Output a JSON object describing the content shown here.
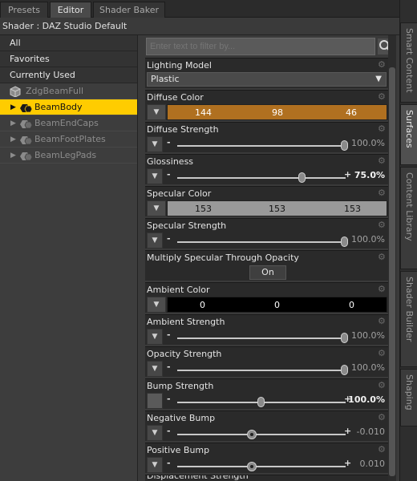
{
  "tabs": [
    "Presets",
    "Editor",
    "Shader Baker"
  ],
  "shader_line": "Shader : DAZ Studio Default",
  "left_categories": [
    "All",
    "Favorites",
    "Currently Used"
  ],
  "tree": [
    {
      "label": "ZdgBeamFull",
      "icon": "figure-icon",
      "expander": ""
    },
    {
      "label": "BeamBody",
      "icon": "surface-group-icon",
      "expander": "▶"
    },
    {
      "label": "BeamEndCaps",
      "icon": "surface-group-icon",
      "expander": "▶"
    },
    {
      "label": "BeamFootPlates",
      "icon": "surface-group-icon",
      "expander": "▶"
    },
    {
      "label": "BeamLegPads",
      "icon": "surface-group-icon",
      "expander": "▶"
    }
  ],
  "filter": {
    "placeholder": "Enter text to filter by..."
  },
  "properties": {
    "lighting_model": {
      "label": "Lighting Model",
      "value": "Plastic"
    },
    "diffuse_color": {
      "label": "Diffuse Color",
      "r": "144",
      "g": "98",
      "b": "46",
      "swatch": "#b07020"
    },
    "diffuse_strength": {
      "label": "Diffuse Strength",
      "value": "100.0%",
      "level": 1.0
    },
    "glossiness": {
      "label": "Glossiness",
      "value": "75.0%",
      "level": 0.75
    },
    "specular_color": {
      "label": "Specular Color",
      "r": "153",
      "g": "153",
      "b": "153",
      "swatch": "#999999"
    },
    "specular_strength": {
      "label": "Specular Strength",
      "value": "100.0%",
      "level": 1.0
    },
    "multiply_specular": {
      "label": "Multiply Specular Through Opacity",
      "value": "On"
    },
    "ambient_color": {
      "label": "Ambient Color",
      "r": "0",
      "g": "0",
      "b": "0",
      "swatch": "#000000"
    },
    "ambient_strength": {
      "label": "Ambient Strength",
      "value": "100.0%",
      "level": 1.0
    },
    "opacity_strength": {
      "label": "Opacity Strength",
      "value": "100.0%",
      "level": 1.0
    },
    "bump_strength": {
      "label": "Bump Strength",
      "value": "100.0%",
      "level": 0.5
    },
    "negative_bump": {
      "label": "Negative Bump",
      "value": "-0.010",
      "level": 0.5
    },
    "positive_bump": {
      "label": "Positive Bump",
      "value": "0.010",
      "level": 0.5
    },
    "displacement_strength": {
      "label": "Displacement Strength"
    }
  },
  "side_tabs": [
    "Smart Content",
    "Surfaces",
    "Content Library",
    "Shader Builder",
    "Shaping"
  ],
  "colors": {
    "selection": "#ffcc00",
    "panel": "#2a2a2a",
    "background": "#3a3a3a"
  }
}
